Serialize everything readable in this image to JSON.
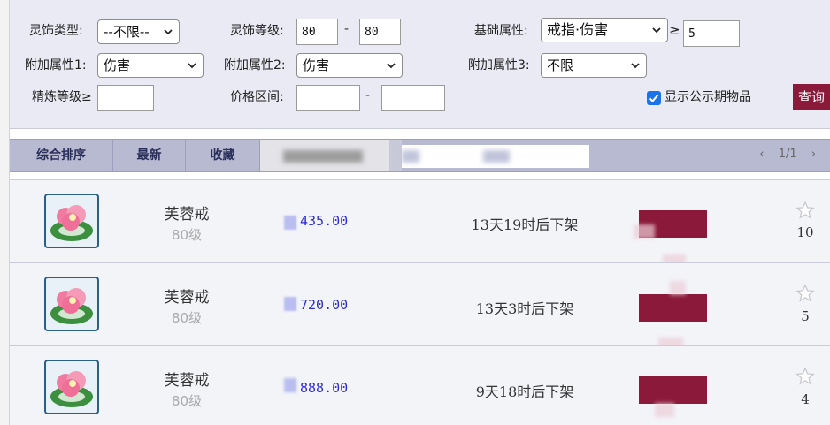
{
  "filters": {
    "type_label": "灵饰类型:",
    "type_value": "--不限--",
    "level_label": "灵饰等级:",
    "level_min": "80",
    "level_max": "80",
    "level_sep": "-",
    "base_attr_label": "基础属性:",
    "base_attr_value": "戒指·伤害",
    "base_attr_op": "≥",
    "base_attr_min": "5",
    "extra1_label": "附加属性1:",
    "extra1_value": "伤害",
    "extra2_label": "附加属性2:",
    "extra2_value": "伤害",
    "extra3_label": "附加属性3:",
    "extra3_value": "不限",
    "refine_label": "精炼等级≥",
    "refine_value": "",
    "price_label": "价格区间:",
    "price_min": "",
    "price_max": "",
    "price_sep": "-",
    "show_public_label": "显示公示期物品",
    "show_public_checked": true,
    "query_label": "查询"
  },
  "sort_tabs": [
    "综合排序",
    "最新",
    "收藏"
  ],
  "pager": {
    "prev": "‹",
    "text": "1/1",
    "next": "›"
  },
  "items": [
    {
      "name": "芙蓉戒",
      "level": "80级",
      "price": "435.00",
      "time_left": "13天19时后下架",
      "fav_count": "10",
      "icon": "lotus-ring-icon"
    },
    {
      "name": "芙蓉戒",
      "level": "80级",
      "price": "720.00",
      "time_left": "13天3时后下架",
      "fav_count": "5",
      "icon": "lotus-ring-icon"
    },
    {
      "name": "芙蓉戒",
      "level": "80级",
      "price": "888.00",
      "time_left": "9天18时后下架",
      "fav_count": "4",
      "icon": "lotus-ring-icon"
    }
  ],
  "colors": {
    "panel_bg": "#e9eaf3",
    "tab_bg": "#b8bad1",
    "accent_button": "#8b1a3a",
    "price_text": "#2b2bd6",
    "checkbox": "#1a73e8"
  }
}
